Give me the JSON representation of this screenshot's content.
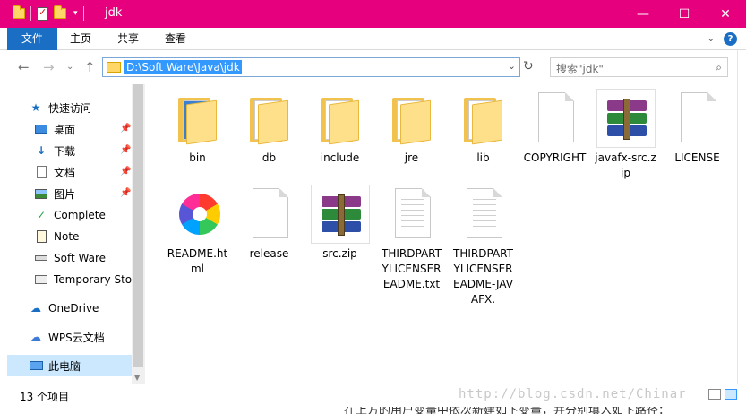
{
  "window": {
    "title": "jdk",
    "controls": {
      "minimize": "—",
      "maximize": "☐",
      "close": "✕"
    }
  },
  "ribbon": {
    "tabs": [
      "文件",
      "主页",
      "共享",
      "查看"
    ]
  },
  "nav": {
    "address": "D:\\Soft Ware\\Java\\jdk",
    "search_placeholder": "搜索\"jdk\""
  },
  "sidebar": {
    "items": [
      {
        "label": "快速访问",
        "icon": "star-icon"
      },
      {
        "label": "桌面",
        "icon": "desktop-icon",
        "pinned": true
      },
      {
        "label": "下载",
        "icon": "download-icon",
        "pinned": true
      },
      {
        "label": "文档",
        "icon": "document-icon",
        "pinned": true
      },
      {
        "label": "图片",
        "icon": "picture-icon",
        "pinned": true
      },
      {
        "label": "Complete",
        "icon": "check-icon"
      },
      {
        "label": "Note",
        "icon": "note-icon"
      },
      {
        "label": "Soft Ware",
        "icon": "drive-icon"
      },
      {
        "label": "Temporary Sto",
        "icon": "printer-icon"
      },
      {
        "label": "OneDrive",
        "icon": "cloud-icon"
      },
      {
        "label": "WPS云文档",
        "icon": "wps-cloud-icon"
      },
      {
        "label": "此电脑",
        "icon": "computer-icon",
        "selected": true
      }
    ]
  },
  "files": [
    {
      "name": "bin",
      "type": "folder"
    },
    {
      "name": "db",
      "type": "folder"
    },
    {
      "name": "include",
      "type": "folder"
    },
    {
      "name": "jre",
      "type": "folder"
    },
    {
      "name": "lib",
      "type": "folder"
    },
    {
      "name": "COPYRIGHT",
      "type": "file"
    },
    {
      "name": "javafx-src.zip",
      "type": "zip"
    },
    {
      "name": "LICENSE",
      "type": "file"
    },
    {
      "name": "README.html",
      "type": "html"
    },
    {
      "name": "release",
      "type": "file"
    },
    {
      "name": "src.zip",
      "type": "zip"
    },
    {
      "name": "THIRDPARTYLICENSEREADME.txt",
      "type": "text"
    },
    {
      "name": "THIRDPARTYLICENSEREADME-JAVAFX.",
      "type": "text"
    }
  ],
  "status": {
    "count": "13 个项目"
  },
  "watermark": "http://blog.csdn.net/Chinar",
  "background_text": "在上方的用户变量中依次新建如下变量，并分别填入如下路径："
}
